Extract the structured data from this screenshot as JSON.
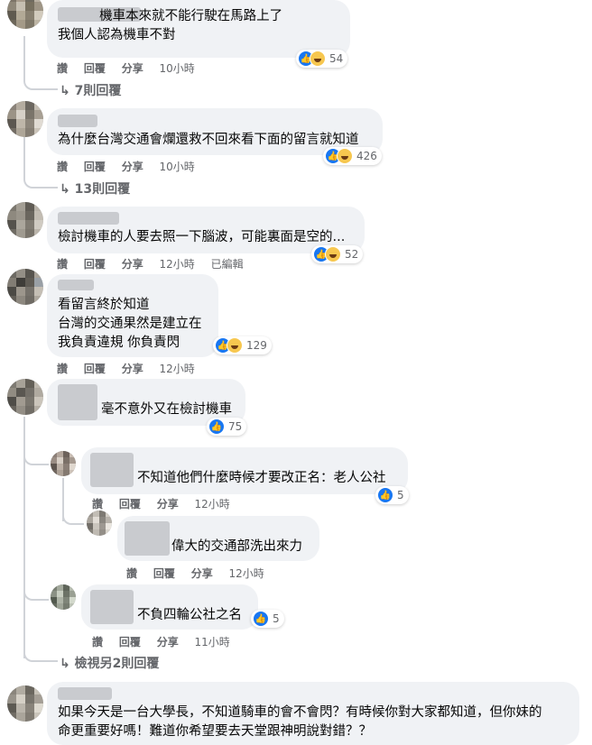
{
  "actions": {
    "like": "讚",
    "reply": "回覆",
    "share": "分享",
    "edited": "已編輯"
  },
  "comments": [
    {
      "text": "          機車本來就不能行駛在馬路上了\n我個人認為機車不對",
      "time": "10小時",
      "reactions": "54",
      "replies": "7則回覆"
    },
    {
      "text": "為什麼台灣交通會爛還救不回來看下面的留言就知道",
      "time": "10小時",
      "reactions": "426",
      "replies": "13則回覆"
    },
    {
      "text": "檢討機車的人要去照一下腦波，可能裏面是空的...",
      "time": "12小時",
      "reactions": "52"
    },
    {
      "text": "看留言終於知道\n台灣的交通果然是建立在\n我負責違規 你負責閃",
      "time": "12小時",
      "reactions": "129"
    },
    {
      "text": "毫不意外又在檢討機車",
      "reactions": "75"
    },
    {
      "text": "不知道他們什麼時候才要改正名：老人公社",
      "time": "12小時",
      "reactions": "5"
    },
    {
      "text": "偉大的交通部洗出來力",
      "time": "12小時"
    },
    {
      "text": "不負四輪公社之名",
      "time": "11小時",
      "reactions": "5"
    },
    {
      "text": "如果今天是一台大學長，不知道騎車的會不會閃？有時候你對大家都知道，但你妹的\n命更重要好嗎！難道你希望要去天堂跟神明說對錯？？"
    }
  ],
  "more_replies": "檢視另2則回覆"
}
